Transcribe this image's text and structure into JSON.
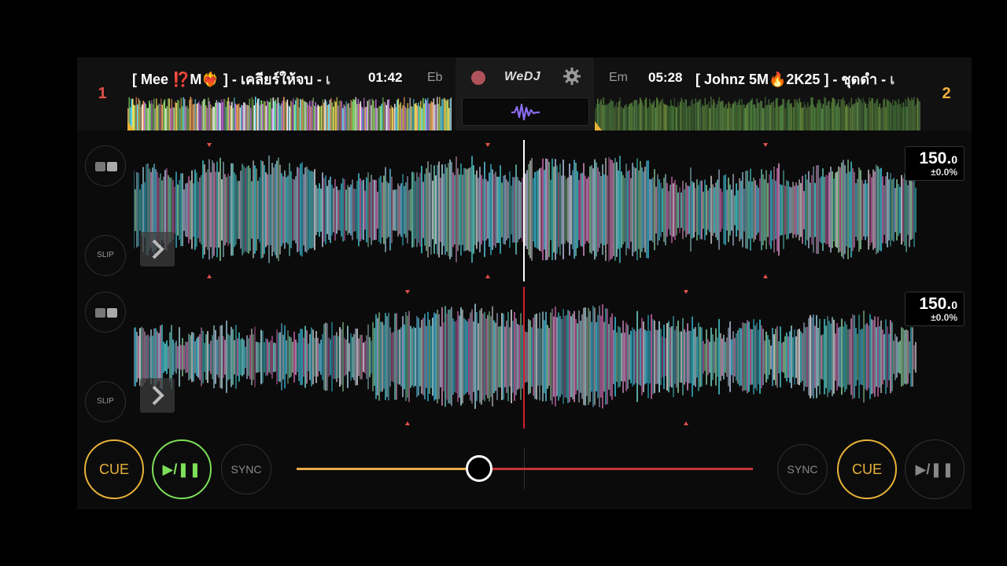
{
  "deck1": {
    "number": "1",
    "title": "[ Mee ⁉️M❤️‍🔥 ] - เคลียร์ให้จบ - เ",
    "time": "01:42",
    "key": "Eb",
    "bpm_int": "150.",
    "bpm_dec": "0",
    "pitch": "±0.0%"
  },
  "deck2": {
    "number": "2",
    "title": "[ Johnz 5M🔥2K25 ] - ชุดดำ - เ",
    "time": "05:28",
    "key": "Em",
    "bpm_int": "150.",
    "bpm_dec": "0",
    "pitch": "±0.0%"
  },
  "center": {
    "brand": "WeDJ"
  },
  "labels": {
    "slip": "SLIP",
    "cue": "CUE",
    "sync": "SYNC",
    "play_pause": "▶/❚❚"
  },
  "colors": {
    "deck1_accent": "#e0504a",
    "deck2_accent": "#f0b040",
    "cue": "#e8b23a",
    "play_active": "#7ee05a",
    "crossfader_left": "#e8a94a",
    "crossfader_right": "#c8323a"
  },
  "crossfader": {
    "position": 0.4
  },
  "icons": {
    "record": "record-icon",
    "settings": "gear-icon",
    "waveform": "waveform-icon",
    "loop": "loop-icon",
    "arrow": "chevron-right-icon"
  }
}
